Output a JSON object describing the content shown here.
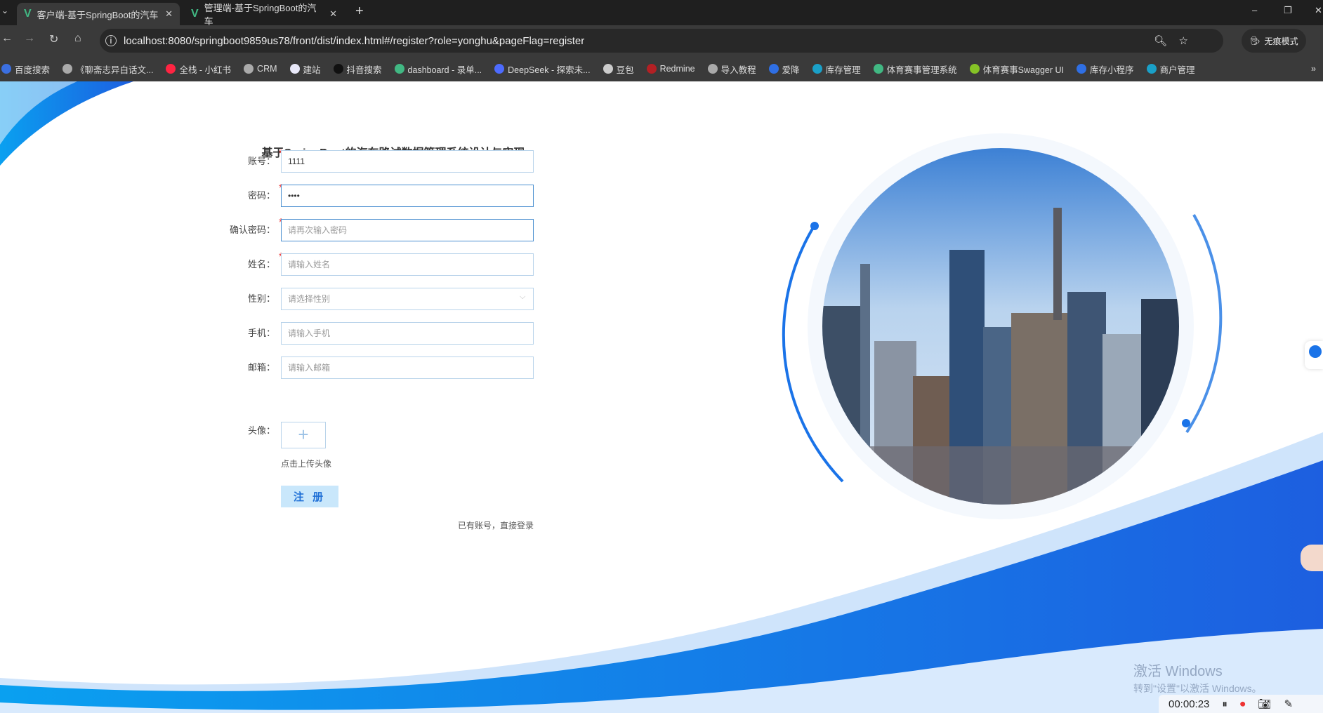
{
  "browser": {
    "tabs": [
      {
        "label": "客户端-基于SpringBoot的汽车",
        "active": true
      },
      {
        "label": "管理端-基于SpringBoot的汽车",
        "active": false
      }
    ],
    "new_tab": "+",
    "url": "localhost:8080/springboot9859us78/front/dist/index.html#/register?role=yonghu&pageFlag=register",
    "incognito": "无痕模式",
    "bookmarks": [
      {
        "label": "百度搜索",
        "color": "#3b6fe0"
      },
      {
        "label": "《聊斋志异白话文...",
        "color": "#aaa"
      },
      {
        "label": "全栈 - 小红书",
        "color": "#ff2442"
      },
      {
        "label": "CRM",
        "color": "#aaa"
      },
      {
        "label": "建站",
        "color": "#e8e8f8"
      },
      {
        "label": "抖音搜索",
        "color": "#111"
      },
      {
        "label": "dashboard - 录单...",
        "color": "#41b883"
      },
      {
        "label": "DeepSeek - 探索未...",
        "color": "#4d6bfe"
      },
      {
        "label": "豆包",
        "color": "#ccc"
      },
      {
        "label": "Redmine",
        "color": "#b32024"
      },
      {
        "label": "导入教程",
        "color": "#aaa"
      },
      {
        "label": "爱降",
        "color": "#2f6fe4"
      },
      {
        "label": "库存管理",
        "color": "#1aa0c8"
      },
      {
        "label": "体育赛事管理系统",
        "color": "#41b883"
      },
      {
        "label": "体育赛事Swagger UI",
        "color": "#85c226"
      },
      {
        "label": "库存小程序",
        "color": "#2f6fe4"
      },
      {
        "label": "商户管理",
        "color": "#1aa0c8"
      }
    ],
    "more": "»"
  },
  "form": {
    "title": "基于SpringBoot的汽车路试数据管理系统设计与实现",
    "fields": [
      {
        "label": "账号：",
        "required": true,
        "value": "1111",
        "placeholder": ""
      },
      {
        "label": "密码：",
        "required": true,
        "value": "••••",
        "placeholder": ""
      },
      {
        "label": "确认密码：",
        "required": true,
        "value": "",
        "placeholder": "请再次输入密码"
      },
      {
        "label": "姓名：",
        "required": true,
        "value": "",
        "placeholder": "请输入姓名"
      },
      {
        "label": "性别：",
        "required": false,
        "value": "",
        "placeholder": "请选择性别"
      },
      {
        "label": "手机：",
        "required": false,
        "value": "",
        "placeholder": "请输入手机"
      },
      {
        "label": "邮箱：",
        "required": false,
        "value": "",
        "placeholder": "请输入邮箱"
      }
    ],
    "avatar_label": "头像：",
    "upload_hint": "点击上传头像",
    "submit": "注 册",
    "login_link": "已有账号，直接登录"
  },
  "watermark": {
    "line1": "激活 Windows",
    "line2": "转到\"设置\"以激活 Windows。"
  },
  "recorder": {
    "time": "00:00:23"
  },
  "colors": {
    "accent": "#1e6fd6",
    "wave": "#1a73e8"
  }
}
